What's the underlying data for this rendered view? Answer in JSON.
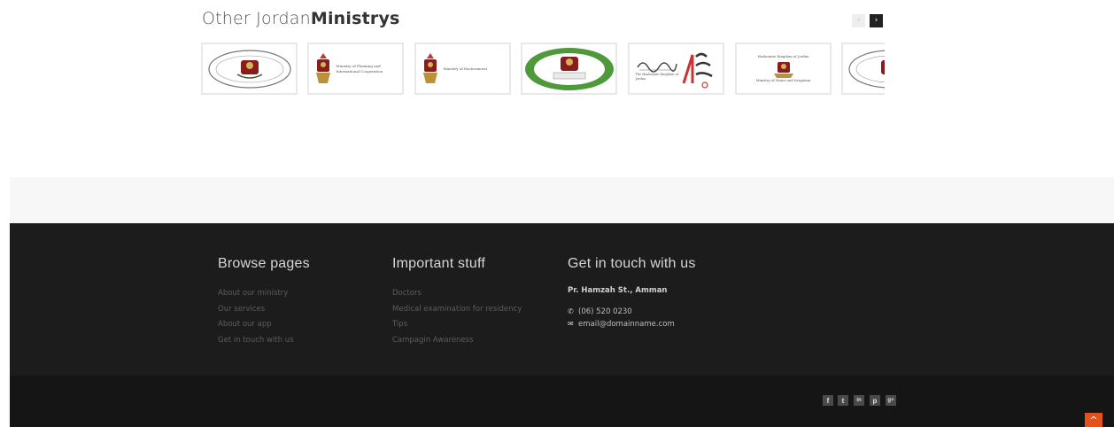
{
  "ministries": {
    "heading_light": "Other Jordan",
    "heading_bold": "Ministrys",
    "prev_label": "‹",
    "next_label": "›",
    "logos": [
      {
        "name": "seal-logo"
      },
      {
        "name": "ministry-of-planning-logo",
        "caption": "Ministry of Planning and International Cooperation"
      },
      {
        "name": "ministry-of-environment-logo",
        "caption": "Ministry of Environment"
      },
      {
        "name": "wreath-seal-logo"
      },
      {
        "name": "arabic-ministry-logo",
        "caption": "The Hashemite Kingdom of Jordan"
      },
      {
        "name": "ministry-of-water-logo",
        "caption_top": "Hashemite Kingdom of Jordan",
        "caption_bottom": "Ministry of Water and Irrigation"
      },
      {
        "name": "seal-logo-repeat"
      }
    ]
  },
  "footer": {
    "browse": {
      "title": "Browse pages",
      "links": [
        "About our ministry",
        "Our services",
        "About our app",
        "Get in touch with us"
      ]
    },
    "important": {
      "title": "Important stuff",
      "links": [
        "Doctors",
        "Medical examination for residency",
        "Tips",
        "Campagin Awareness"
      ]
    },
    "contact": {
      "title": "Get in touch with us",
      "address": "Pr. Hamzah St., Amman",
      "phone": "(06) 520 0230",
      "email": "email@domainname.com"
    }
  },
  "social": [
    "f",
    "t",
    "in",
    "p",
    "g+"
  ],
  "scroll_top_label": "^",
  "colors": {
    "footer_bg": "#1c1c1c",
    "bottom_bar_bg": "#151515",
    "accent": "#e4521b"
  }
}
